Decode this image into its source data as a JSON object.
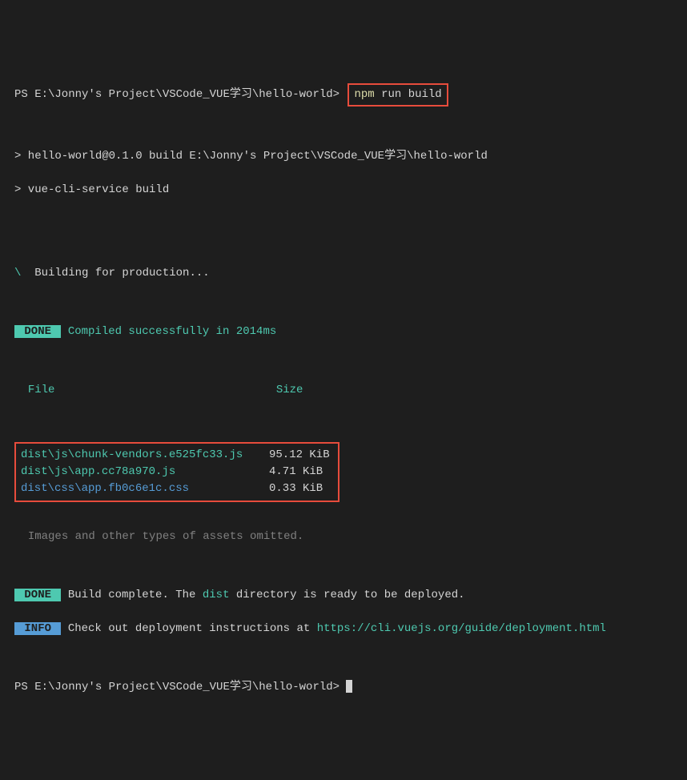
{
  "prompt1": {
    "prefix": "PS E:\\Jonny's Project\\VSCode_VUE学习\\hello-world>",
    "cmd_part1": "npm",
    "cmd_part2": "run build"
  },
  "exec_lines": {
    "l1": "> hello-world@0.1.0 build E:\\Jonny's Project\\VSCode_VUE学习\\hello-world",
    "l2": "> vue-cli-service build"
  },
  "building": {
    "slash": "\\",
    "text": "  Building for production..."
  },
  "done1": {
    "badge": " DONE ",
    "text": " Compiled successfully in 2014ms"
  },
  "table": {
    "head_file": "File",
    "head_size": "Size",
    "rows": [
      {
        "file": "dist\\js\\chunk-vendors.e525fc33.js",
        "size": "95.12 KiB"
      },
      {
        "file": "dist\\js\\app.cc78a970.js",
        "size": "4.71 KiB"
      },
      {
        "file": "dist\\css\\app.fb0c6e1c.css",
        "size": "0.33 KiB"
      }
    ]
  },
  "assets_omitted": "Images and other types of assets omitted.",
  "done2": {
    "badge": " DONE ",
    "prefix": " Build complete. The ",
    "dist": "dist",
    "suffix": " directory is ready to be deployed."
  },
  "info": {
    "badge": " INFO ",
    "prefix": " Check out deployment instructions at ",
    "url": "https://cli.vuejs.org/guide/deployment.html"
  },
  "prompt2": "PS E:\\Jonny's Project\\VSCode_VUE学习\\hello-world> "
}
